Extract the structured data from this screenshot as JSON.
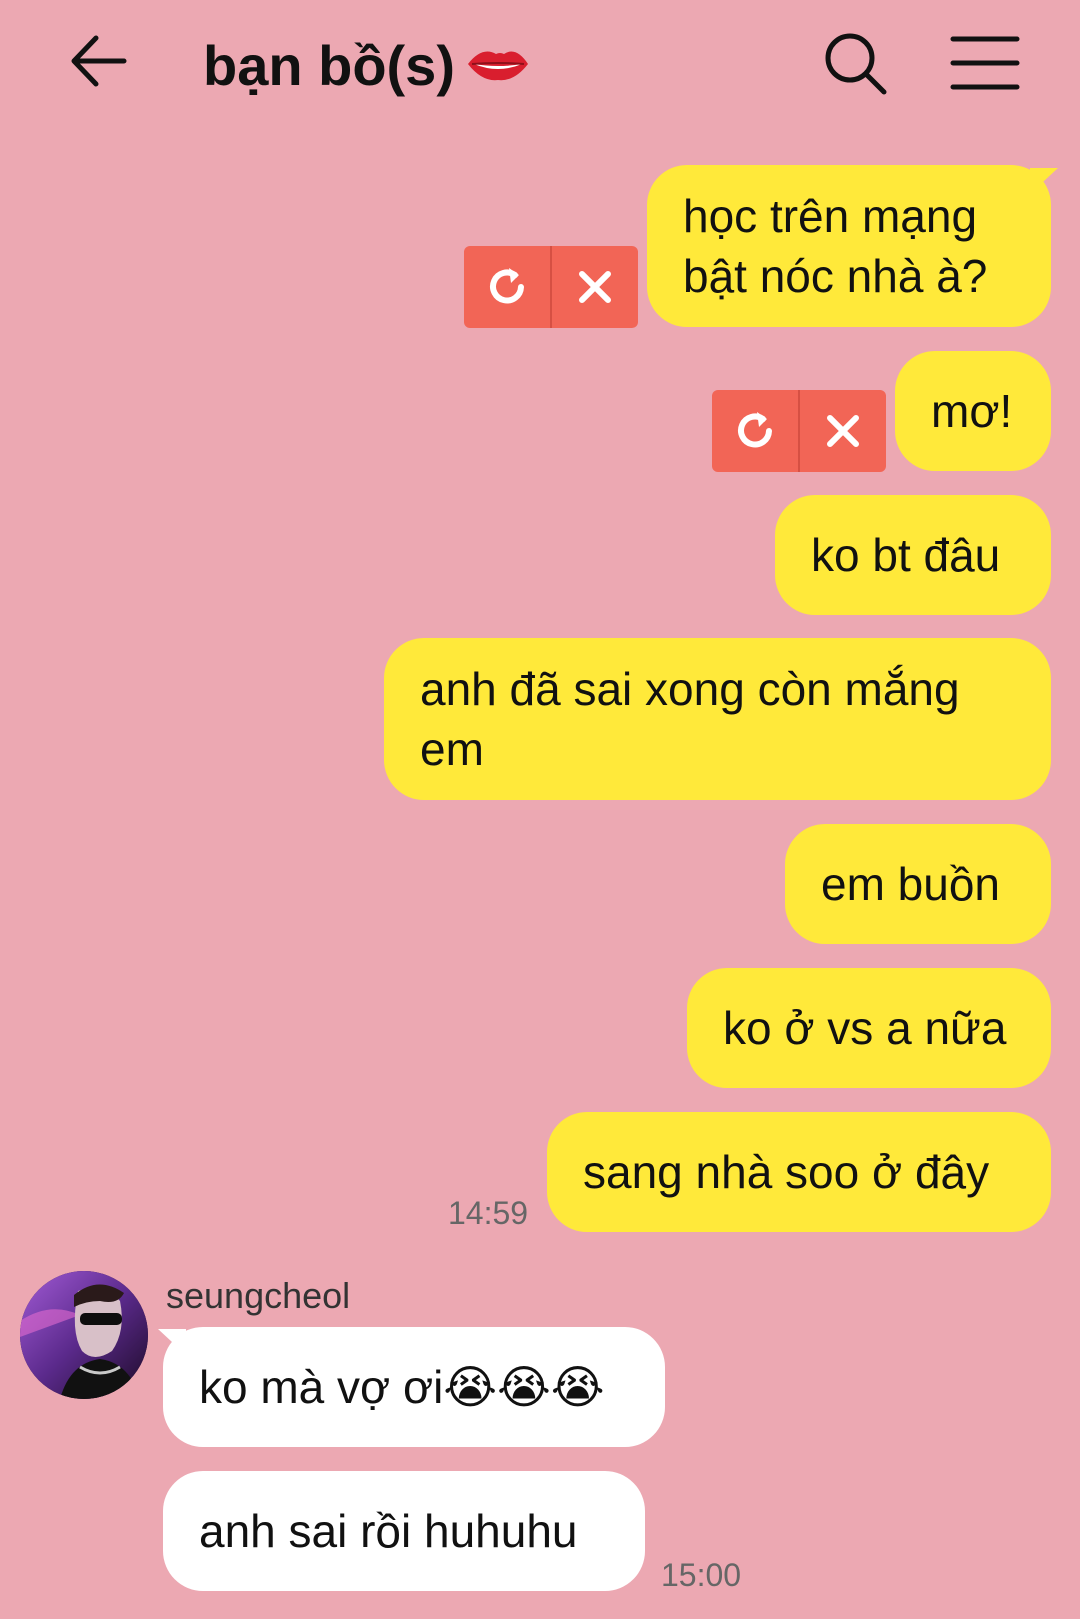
{
  "header": {
    "title": "bạn bồ(s)",
    "back_icon": "arrow-left-icon",
    "search_icon": "search-icon",
    "menu_icon": "hamburger-menu-icon",
    "title_emoji": "lips-icon"
  },
  "messages_out": [
    {
      "text": "học trên mạng\nbật nóc nhà à?",
      "failed": true
    },
    {
      "text": "mơ!",
      "failed": true
    },
    {
      "text": "ko bt đâu"
    },
    {
      "text": "anh đã sai xong còn mắng\nem"
    },
    {
      "text": "em buồn"
    },
    {
      "text": "ko ở vs a nữa"
    },
    {
      "text": "sang nhà soo ở đây"
    }
  ],
  "time_out": "14:59",
  "incoming": {
    "sender": "seungcheol",
    "messages": [
      {
        "text": "ko mà vợ ơi😭😭😭"
      },
      {
        "text": "anh sai rồi huhuhu"
      }
    ],
    "time": "15:00"
  },
  "colors": {
    "background": "#ECA8B2",
    "outgoing_bubble": "#FFE93A",
    "incoming_bubble": "#FFFFFF",
    "failed_control": "#F26556"
  }
}
